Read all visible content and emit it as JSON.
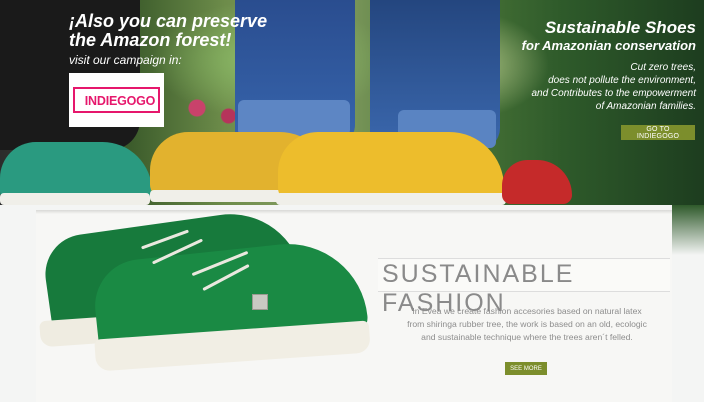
{
  "hero": {
    "campaign_heading_line1": "¡Also you can preserve",
    "campaign_heading_line2": "the Amazon forest!",
    "campaign_subtext": "visit our campaign  in:",
    "logo_text": "INDIEGOGO",
    "title_line1": "Sustainable Shoes",
    "title_line2": "for Amazonian conservation",
    "body_line1": "Cut zero trees,",
    "body_line2": "does not pollute the environment,",
    "body_line3": "and Contributes to the empowerment",
    "body_line4": "of Amazonian families.",
    "cta_label": "GO TO INDIEGOGO"
  },
  "feature": {
    "title": "SUSTAINABLE FASHION",
    "body_line1": "In Evea we create fashion accesories based on natural latex",
    "body_line2": "from shiringa rubber tree, the work is based on an old, ecologic",
    "body_line3": "and sustainable technique where the trees aren´t felled.",
    "cta_label": "SEE MORE"
  },
  "colors": {
    "accent": "#7c8e2c",
    "logo_pink": "#e6176c"
  }
}
